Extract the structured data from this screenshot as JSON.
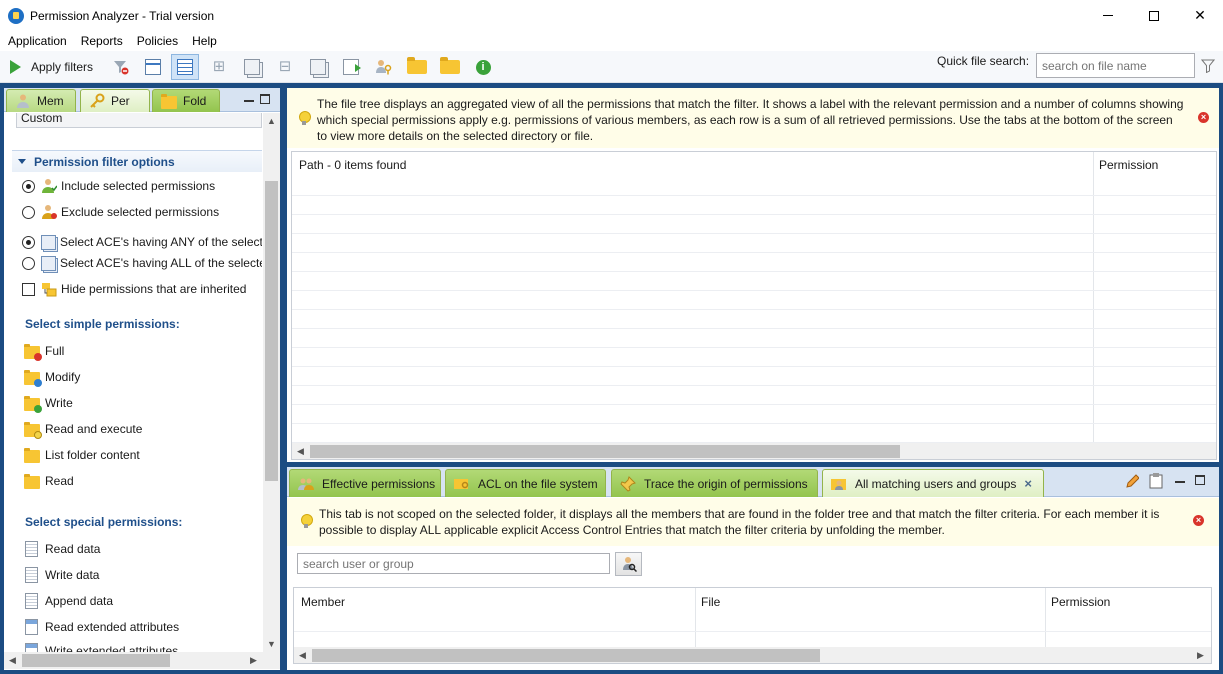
{
  "window": {
    "title": "Permission Analyzer - Trial version"
  },
  "menu": [
    "Application",
    "Reports",
    "Policies",
    "Help"
  ],
  "toolbar": {
    "apply_filters": "Apply filters",
    "quick_search_label": "Quick file search:",
    "quick_search_placeholder": "search on file name"
  },
  "left_panel": {
    "tabs": [
      {
        "label": "Mem",
        "icon": "members-icon"
      },
      {
        "label": "Per",
        "icon": "permissions-key-icon"
      },
      {
        "label": "Fold",
        "icon": "folder-icon"
      }
    ],
    "custom_value": "Custom",
    "section_title": "Permission filter options",
    "filter_options": [
      {
        "label": "Include selected permissions",
        "type": "radio",
        "checked": true
      },
      {
        "label": "Exclude selected permissions",
        "type": "radio",
        "checked": false
      },
      {
        "label": "Select ACE's having ANY of the selecte",
        "type": "radio",
        "checked": true
      },
      {
        "label": "Select ACE's having ALL of the selecte",
        "type": "radio",
        "checked": false
      },
      {
        "label": "Hide permissions that are inherited",
        "type": "checkbox",
        "checked": false
      }
    ],
    "simple_title": "Select simple permissions:",
    "simple_permissions": [
      "Full",
      "Modify",
      "Write",
      "Read and execute",
      "List folder content",
      "Read"
    ],
    "special_title": "Select special permissions:",
    "special_permissions": [
      "Read data",
      "Write data",
      "Append data",
      "Read extended attributes",
      "Write extended attributes"
    ]
  },
  "file_tree": {
    "info": "The file tree displays an aggregated view of all the permissions that match the filter. It shows a label with the relevant permission and a number of columns showing which special permissions apply e.g. permissions of various members, as each row is a sum of all retrieved permissions. Use the tabs at the bottom of the screen to view more details on the selected directory or file.",
    "col_path": "Path - 0 items found",
    "col_permission": "Permission"
  },
  "bottom_panel": {
    "tabs": [
      {
        "label": "Effective permissions",
        "selected": false
      },
      {
        "label": "ACL on the file system",
        "selected": false
      },
      {
        "label": "Trace the origin of permissions",
        "selected": false
      },
      {
        "label": "All matching users and groups",
        "selected": true
      }
    ],
    "info": "This tab is not scoped on the selected folder, it displays all the members that are found in the folder tree and that match the filter criteria. For each member it is possible to display ALL applicable explicit Access Control Entries that match the filter criteria by unfolding the member.",
    "search_placeholder": "search user or group",
    "col_member": "Member",
    "col_file": "File",
    "col_permission": "Permission"
  },
  "colors": {
    "frame": "#1c4c82",
    "tab_green": "#93c44e",
    "heading_blue": "#1f4f8a",
    "banner": "#fffde8"
  }
}
